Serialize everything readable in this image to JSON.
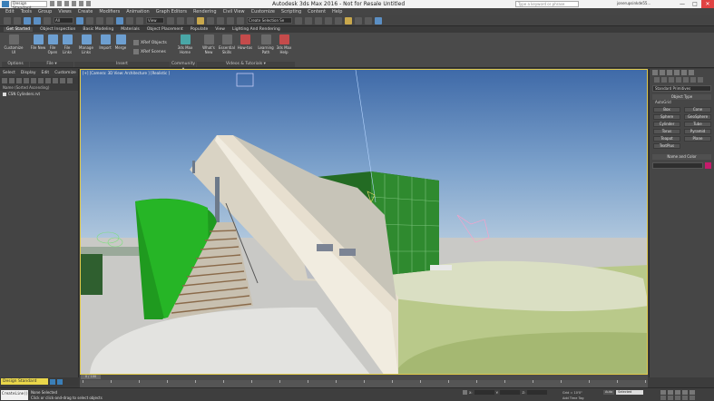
{
  "titlebar": {
    "workspace": "Design Standard",
    "title": "Autodesk 3ds Max 2016 - Not for Resale   Untitled",
    "search_placeholder": "Type a keyword or phrase",
    "user": "jonerupsinkde55...",
    "min": "—",
    "max": "□",
    "close": "✕"
  },
  "menu": [
    "Edit",
    "Tools",
    "Group",
    "Views",
    "Create",
    "Modifiers",
    "Animation",
    "Graph Editors",
    "Rendering",
    "Civil View",
    "Customize",
    "Scripting",
    "Content",
    "Help"
  ],
  "toolbar": {
    "filter": "All",
    "view": "View",
    "selection_set": "Create Selection Se"
  },
  "ribbon_tabs": [
    "Get Started",
    "Object Inspection",
    "Basic Modeling",
    "Materials",
    "Object Placement",
    "Populate",
    "View",
    "Lighting And Rendering"
  ],
  "ribbon": {
    "customize": "Customize UI",
    "file_new": "File New",
    "file_open": "File Open",
    "file_links": "File Links",
    "manage_links": "Manage Links",
    "import": "Import",
    "merge": "Merge",
    "xref_objects": "XRef Objects",
    "xref_scenes": "XRef Scenes",
    "max_home": "3ds Max Home",
    "whats_new": "What's New",
    "essential_skills": "Essential Skills",
    "how_tos": "How-tos",
    "learning_path": "Learning Path",
    "max_help": "3ds Max Help",
    "group_options": "Options",
    "group_file": "File ▾",
    "group_insert": "Insert",
    "group_community": "Community ▾",
    "group_videos": "Videos & Tutorials ▾"
  },
  "explorer": {
    "tabs": [
      "Select",
      "Display",
      "Edit",
      "Customize"
    ],
    "column": "Name (Sorted Ascending)",
    "items": [
      "CSN Cylinders.rvt"
    ]
  },
  "viewport": {
    "label": "[+] [Camera: 3D View: Architecture ] [Realistic ]"
  },
  "cmdpanel": {
    "dropdown": "Standard Primitives",
    "rollout_object": "Object Type",
    "autogrid": "AutoGrid",
    "objects": [
      "Box",
      "Cone",
      "Sphere",
      "GeoSphere",
      "Cylinder",
      "Tube",
      "Torus",
      "Pyramid",
      "Teapot",
      "Plane",
      "TextPlus"
    ],
    "rollout_name": "Name and Color",
    "color": "#c41b6b"
  },
  "timeline": {
    "slider": "0 / 100"
  },
  "workspace_bottom": "Design Standard",
  "status": {
    "script": "CreateLine():",
    "selected": "None Selected",
    "prompt": "Click or click-and-drag to select objects",
    "x": "X:",
    "y": "Y:",
    "z": "Z:",
    "grid": "Grid = 10'0\"",
    "add_tag": "Add Time Tag",
    "auto": "Auto",
    "set_key": "Set K.",
    "key_filter": "Selected",
    "key_filters_btn": "Key Filters..."
  }
}
